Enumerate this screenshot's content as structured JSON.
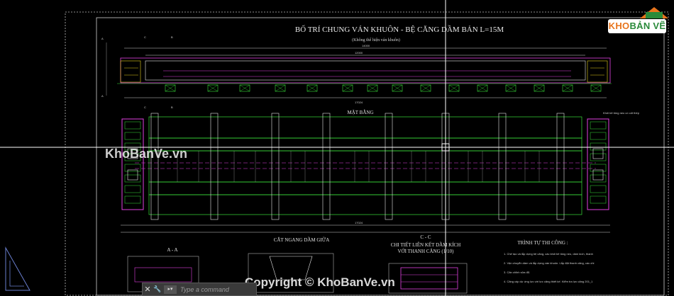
{
  "drawing": {
    "title": "BỐ TRÍ CHUNG VÁN KHUÔN - BỆ CĂNG DẦM BẢN L=15M",
    "subtitle": "(Không thể hiện ván khuôn)",
    "plan_label": "MẶT BẰNG",
    "section_aa": "A - A",
    "section_cc": "C - C",
    "cross_section": "CẮT NGANG DẦM GIỮA",
    "detail_title_1": "CHI TIẾT LIÊN KẾT DẦM KÍCH",
    "detail_title_2": "VỚI THANH CĂNG (1/10)",
    "sequence_title": "TRÌNH TỰ THI CÔNG :",
    "sequence_lines": [
      "1. Chế tạo và lắp dựng bệ căng, các khối bê tông neo, dầm kích, thanh",
      "2. Vận chuyển dầm và lắp dựng ván khuôn. Lắp đặt thanh căng, các chi",
      "3. Căn chỉnh sửa đổ.",
      "4. Căng cáp dự ứng lực với lực căng thiết kế. Kiểm tra lực căng 201_1"
    ],
    "marker_a": "A",
    "marker_b": "B",
    "marker_c": "C",
    "dim_total_top": "17024",
    "dim_total_bottom": "17024",
    "dim_inner": "14000",
    "dim_inner_2": "12000",
    "dim_span": "2400",
    "annotation_right": "Khối bê tông neo có cốt thép"
  },
  "watermarks": {
    "center": "KhoBanVe.vn",
    "copyright": "Copyright © KhoBanVe.vn"
  },
  "logo": {
    "prefix": "KHO",
    "suffix": "BẢN VẼ"
  },
  "command_line": {
    "close": "✕",
    "placeholder": "Type a command",
    "selector": "▸▾"
  },
  "colors": {
    "background": "#000000",
    "frame": "#d9d9d9",
    "magenta": "#e040e0",
    "green": "#3adf3a",
    "white": "#e6e6e6",
    "yellow": "#e6d21a",
    "grey": "#8a8a8a",
    "crosshair": "#ffffff"
  }
}
